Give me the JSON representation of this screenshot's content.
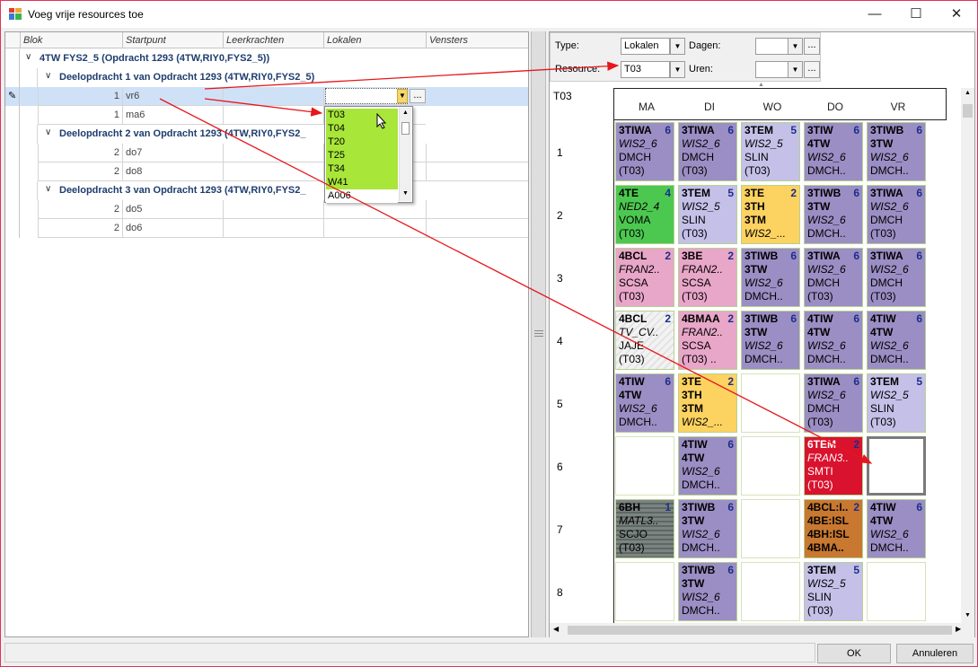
{
  "window": {
    "title": "Voeg vrije resources toe",
    "icon": "app-window-icon"
  },
  "grid": {
    "headers": [
      "Blok",
      "Startpunt",
      "Leerkrachten",
      "Lokalen",
      "Vensters"
    ],
    "group": "4TW FYS2_5 (Opdracht 1293 (4TW,RIY0,FYS2_5))",
    "subgroups": [
      {
        "title": "Deelopdracht 1 van Opdracht 1293 (4TW,RIY0,FYS2_5)",
        "rows": [
          {
            "n": "1",
            "s": "vr6"
          },
          {
            "n": "1",
            "s": "ma6"
          }
        ]
      },
      {
        "title": "Deelopdracht 2 van Opdracht 1293 (4TW,RIY0,FYS2_",
        "rows": [
          {
            "n": "2",
            "s": "do7"
          },
          {
            "n": "2",
            "s": "do8"
          }
        ]
      },
      {
        "title": "Deelopdracht 3 van Opdracht 1293 (4TW,RIY0,FYS2_",
        "rows": [
          {
            "n": "2",
            "s": "do5"
          },
          {
            "n": "2",
            "s": "do6"
          }
        ]
      }
    ],
    "ellipsis": "...",
    "dropdown": [
      "T03",
      "T04",
      "T20",
      "T25",
      "T34",
      "W41",
      "A006"
    ]
  },
  "filter": {
    "type_label": "Type:",
    "type_value": "Lokalen",
    "days_label": "Dagen:",
    "days_value": "",
    "resource_label": "Resource:",
    "resource_value": "T03",
    "hours_label": "Uren:",
    "hours_value": "",
    "ellipsis": "..."
  },
  "schedule": {
    "resource": "T03",
    "days": [
      "MA",
      "DI",
      "WO",
      "DO",
      "VR"
    ],
    "periods": [
      "1",
      "2",
      "3",
      "4",
      "5",
      "6",
      "7",
      "8"
    ],
    "cells": [
      [
        {
          "a": "3TIWA",
          "b": "",
          "c": "WIS2_6",
          "d": "DMCH",
          "e": "(T03)",
          "n": "6",
          "col": "#9b8ec4"
        },
        {
          "a": "3TIWA",
          "b": "",
          "c": "WIS2_6",
          "d": "DMCH",
          "e": "(T03)",
          "n": "6",
          "col": "#9b8ec4"
        },
        {
          "a": "3TEM",
          "b": "",
          "c": "WIS2_5",
          "d": "SLIN",
          "e": "(T03)",
          "n": "5",
          "col": "#c4c0e8"
        },
        {
          "a": "3TIW",
          "b": "4TW",
          "c": "WIS2_6",
          "d": "DMCH..",
          "e": "",
          "n": "6",
          "col": "#9b8ec4"
        },
        {
          "a": "3TIWB",
          "b": "3TW",
          "c": "WIS2_6",
          "d": "DMCH..",
          "e": "",
          "n": "6",
          "col": "#9b8ec4"
        }
      ],
      [
        {
          "a": "4TE",
          "b": "",
          "c": "NED2_4",
          "d": "VOMA",
          "e": "(T03)",
          "n": "4",
          "col": "#4cc850"
        },
        {
          "a": "3TEM",
          "b": "",
          "c": "WIS2_5",
          "d": "SLIN",
          "e": "(T03)",
          "n": "5",
          "col": "#c4c0e8"
        },
        {
          "a": "3TE",
          "b": "3TH",
          "c": "3TM",
          "d": "WIS2_...",
          "e": "",
          "n": "2",
          "col": "#fcd261"
        },
        {
          "a": "3TIWB",
          "b": "3TW",
          "c": "WIS2_6",
          "d": "DMCH..",
          "e": "",
          "n": "6",
          "col": "#9b8ec4"
        },
        {
          "a": "3TIWA",
          "b": "",
          "c": "WIS2_6",
          "d": "DMCH",
          "e": "(T03)",
          "n": "6",
          "col": "#9b8ec4"
        }
      ],
      [
        {
          "a": "4BCL",
          "b": "",
          "c": "FRAN2..",
          "d": "SCSA",
          "e": "(T03)",
          "n": "2",
          "col": "#e8a6c8"
        },
        {
          "a": "3BE",
          "b": "",
          "c": "FRAN2..",
          "d": "SCSA",
          "e": "(T03)",
          "n": "2",
          "col": "#e8a6c8"
        },
        {
          "a": "3TIWB",
          "b": "3TW",
          "c": "WIS2_6",
          "d": "DMCH..",
          "e": "",
          "n": "6",
          "col": "#9b8ec4"
        },
        {
          "a": "3TIWA",
          "b": "",
          "c": "WIS2_6",
          "d": "DMCH",
          "e": "(T03)",
          "n": "6",
          "col": "#9b8ec4"
        },
        {
          "a": "3TIWA",
          "b": "",
          "c": "WIS2_6",
          "d": "DMCH",
          "e": "(T03)",
          "n": "6",
          "col": "#9b8ec4"
        }
      ],
      [
        {
          "a": "4BCL",
          "b": "",
          "c": "TV_CV..",
          "d": "JAJE",
          "e": "(T03)",
          "n": "2",
          "col": "#eeeeee"
        },
        {
          "a": "4BMAA",
          "b": "",
          "c": "FRAN2..",
          "d": "SCSA",
          "e": "(T03) ..",
          "n": "2",
          "col": "#e8a6c8"
        },
        {
          "a": "3TIWB",
          "b": "3TW",
          "c": "WIS2_6",
          "d": "DMCH..",
          "e": "",
          "n": "6",
          "col": "#9b8ec4"
        },
        {
          "a": "4TIW",
          "b": "4TW",
          "c": "WIS2_6",
          "d": "DMCH..",
          "e": "",
          "n": "6",
          "col": "#9b8ec4"
        },
        {
          "a": "4TIW",
          "b": "4TW",
          "c": "WIS2_6",
          "d": "DMCH..",
          "e": "",
          "n": "6",
          "col": "#9b8ec4"
        }
      ],
      [
        {
          "a": "4TIW",
          "b": "4TW",
          "c": "WIS2_6",
          "d": "DMCH..",
          "e": "",
          "n": "6",
          "col": "#9b8ec4"
        },
        {
          "a": "3TE",
          "b": "3TH",
          "c": "3TM",
          "d": "WIS2_...",
          "e": "",
          "n": "2",
          "col": "#fcd261"
        },
        null,
        {
          "a": "3TIWA",
          "b": "",
          "c": "WIS2_6",
          "d": "DMCH",
          "e": "(T03)",
          "n": "6",
          "col": "#9b8ec4"
        },
        {
          "a": "3TEM",
          "b": "",
          "c": "WIS2_5",
          "d": "SLIN",
          "e": "(T03)",
          "n": "5",
          "col": "#c4c0e8"
        }
      ],
      [
        null,
        {
          "a": "4TIW",
          "b": "4TW",
          "c": "WIS2_6",
          "d": "DMCH..",
          "e": "",
          "n": "6",
          "col": "#9b8ec4"
        },
        null,
        {
          "a": "6TEM",
          "b": "",
          "c": "FRAN3..",
          "d": "SMTI",
          "e": "(T03)",
          "n": "2",
          "col": "#d9122e"
        },
        null
      ],
      [
        {
          "a": "6BH",
          "b": "",
          "c": "MATL3..",
          "d": "SCJO",
          "e": "(T03)",
          "n": "1",
          "col": "#6b7470"
        },
        {
          "a": "3TIWB",
          "b": "3TW",
          "c": "WIS2_6",
          "d": "DMCH..",
          "e": "",
          "n": "6",
          "col": "#9b8ec4"
        },
        null,
        {
          "a": "4BCL:I..",
          "b": "4BE:ISL",
          "c": "4BH:ISL",
          "d": "4BMA..",
          "e": "",
          "n": "2",
          "col": "#c87830"
        },
        {
          "a": "4TIW",
          "b": "4TW",
          "c": "WIS2_6",
          "d": "DMCH..",
          "e": "",
          "n": "6",
          "col": "#9b8ec4"
        }
      ],
      [
        null,
        {
          "a": "3TIWB",
          "b": "3TW",
          "c": "WIS2_6",
          "d": "DMCH..",
          "e": "",
          "n": "6",
          "col": "#9b8ec4"
        },
        null,
        {
          "a": "3TEM",
          "b": "",
          "c": "WIS2_5",
          "d": "SLIN",
          "e": "(T03)",
          "n": "5",
          "col": "#c4c0e8"
        },
        null
      ]
    ]
  },
  "buttons": {
    "ok": "OK",
    "cancel": "Annuleren"
  }
}
